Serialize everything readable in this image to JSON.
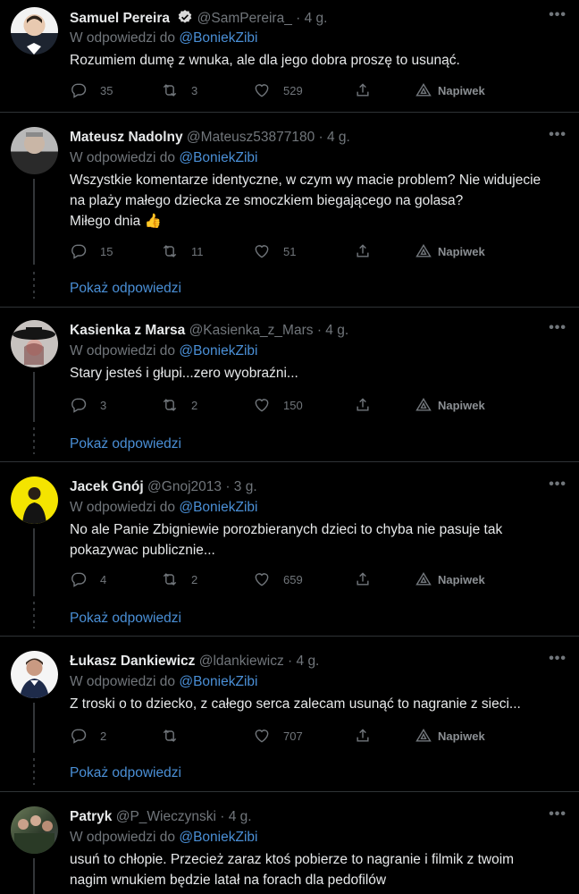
{
  "reply_prefix": "W odpowiedzi do",
  "show_replies_label": "Pokaż odpowiedzi",
  "tip_label": "Napiwek",
  "more_glyph": "•••",
  "colors": {
    "link": "#4a8fd6",
    "muted": "#71767b",
    "background": "#000000",
    "border": "#2f3336"
  },
  "tweets": [
    {
      "name": "Samuel Pereira",
      "verified": true,
      "handle": "@SamPereira_",
      "time": "· 4 g.",
      "reply_to": "@BoniekZibi",
      "lines": [
        "Rozumiem dumę z wnuka, ale dla jego dobra proszę to usunąć."
      ],
      "replies": "35",
      "retweets": "3",
      "likes": "529"
    },
    {
      "name": "Mateusz Nadolny",
      "verified": false,
      "handle": "@Mateusz53877180",
      "time": "· 4 g.",
      "reply_to": "@BoniekZibi",
      "lines": [
        "Wszystkie komentarze identyczne, w czym wy macie problem? Nie widujecie",
        "na plaży małego dziecka ze smoczkiem biegającego na golasa?",
        "Miłego dnia 👍"
      ],
      "replies": "15",
      "retweets": "11",
      "likes": "51"
    },
    {
      "name": "Kasienka z Marsa",
      "verified": false,
      "handle": "@Kasienka_z_Mars",
      "time": "· 4 g.",
      "reply_to": "@BoniekZibi",
      "lines": [
        "Stary jesteś i głupi...zero wyobraźni..."
      ],
      "replies": "3",
      "retweets": "2",
      "likes": "150"
    },
    {
      "name": "Jacek Gnój",
      "verified": false,
      "handle": "@Gnoj2013",
      "time": "· 3 g.",
      "reply_to": "@BoniekZibi",
      "lines": [
        "No ale Panie Zbigniewie porozbieranych dzieci to chyba nie pasuje tak",
        "pokazywac publicznie..."
      ],
      "replies": "4",
      "retweets": "2",
      "likes": "659"
    },
    {
      "name": "Łukasz Dankiewicz",
      "verified": false,
      "handle": "@ldankiewicz",
      "time": "· 4 g.",
      "reply_to": "@BoniekZibi",
      "lines": [
        "Z troski o to dziecko, z całego serca zalecam usunąć to nagranie z sieci..."
      ],
      "replies": "2",
      "retweets": "",
      "likes": "707"
    },
    {
      "name": "Patryk",
      "verified": false,
      "handle": "@P_Wieczynski",
      "time": "· 4 g.",
      "reply_to": "@BoniekZibi",
      "lines": [
        "usuń to chłopie. Przecież zaraz ktoś pobierze to nagranie i filmik z twoim",
        "nagim wnukiem będzie latał na forach dla pedofilów"
      ]
    }
  ]
}
